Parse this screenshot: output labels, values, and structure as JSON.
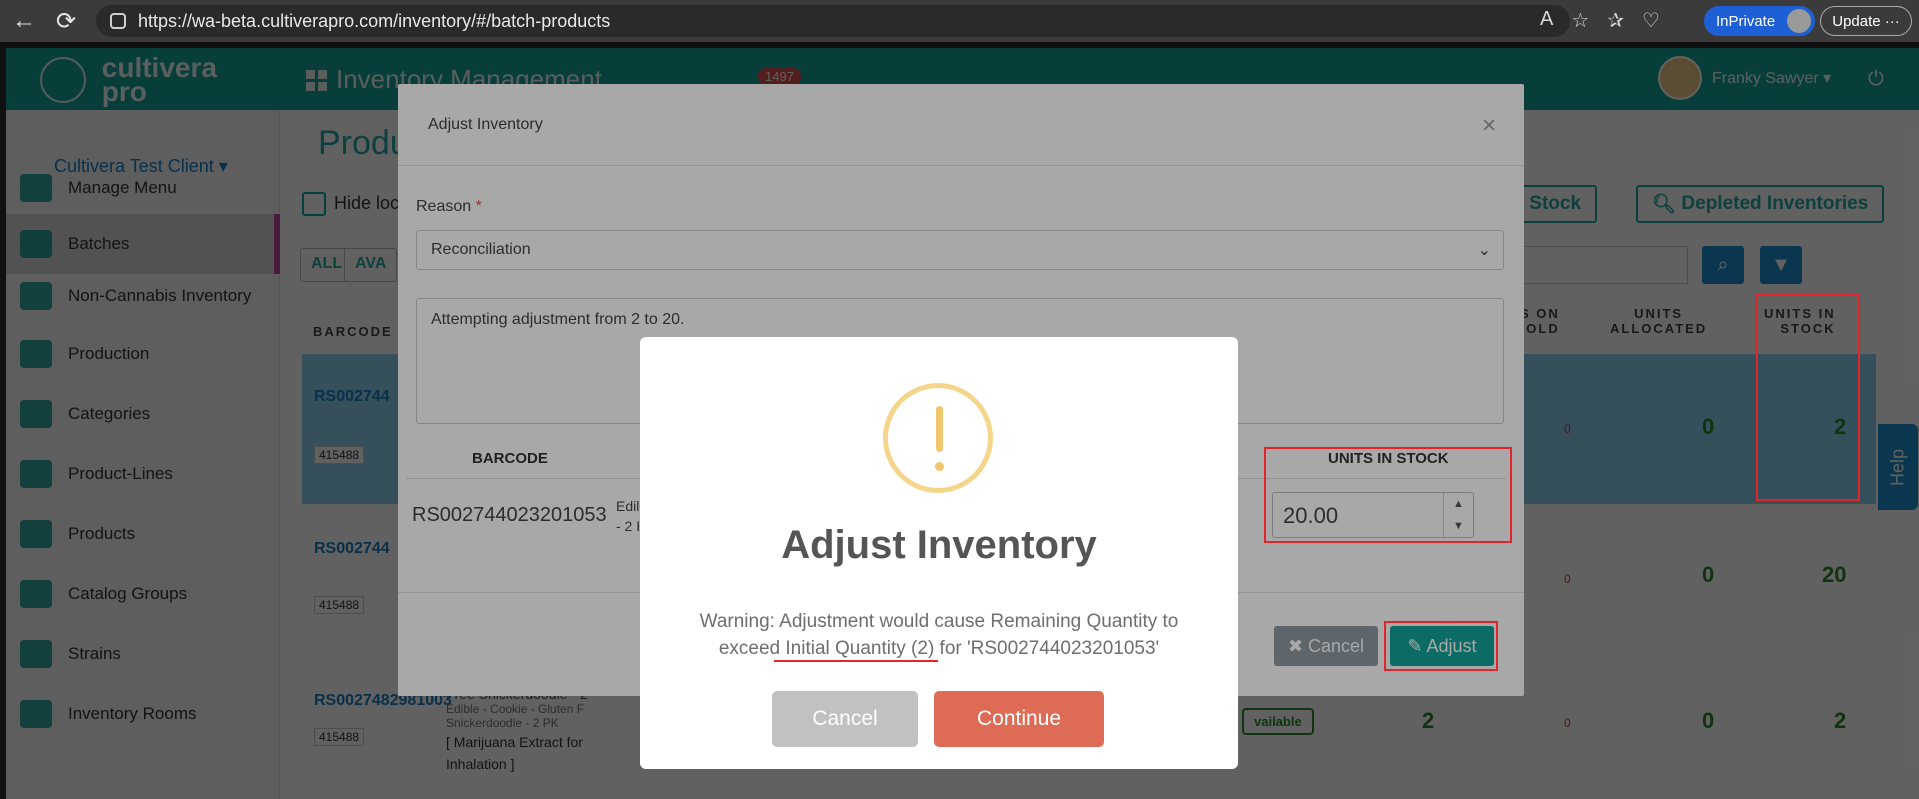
{
  "browser": {
    "url": "https://wa-beta.cultiverapro.com/inventory/#/batch-products",
    "inprivate_label": "InPrivate",
    "update_label": "Update ···"
  },
  "header": {
    "logo_line1": "cultivera",
    "logo_line2": "pro",
    "module_title": "Inventory Management",
    "notification_count": "1497",
    "user_name": "Franky Sawyer ▾"
  },
  "sidebar": {
    "client": "Cultivera Test Client ▾",
    "items": [
      {
        "label": "Manage Menu"
      },
      {
        "label": "Batches"
      },
      {
        "label": "Non-Cannabis Inventory"
      },
      {
        "label": "Production"
      },
      {
        "label": "Categories"
      },
      {
        "label": "Product-Lines"
      },
      {
        "label": "Products"
      },
      {
        "label": "Catalog Groups"
      },
      {
        "label": "Strains"
      },
      {
        "label": "Inventory Rooms"
      }
    ]
  },
  "main": {
    "page_title": "Produ",
    "hide_label": "Hide loc",
    "tab_all": "ALL",
    "tab_ava": "AVA",
    "only_in_stock": "ly in Stock",
    "depleted": "Depleted Inventories",
    "col_barcode": "BARCODE",
    "col_on_hold_1": "TS ON",
    "col_on_hold_2": "HOLD",
    "col_allocated_1": "UNITS",
    "col_allocated_2": "ALLOCATED",
    "col_instock_1": "UNITS IN",
    "col_instock_2": "STOCK",
    "rows": [
      {
        "barcode": "RS002744",
        "tag": "415488",
        "hold": "0",
        "allocated": "0",
        "instock": "2"
      },
      {
        "barcode": "RS002744",
        "tag": "415488",
        "hold": "0",
        "allocated": "0",
        "instock": "20"
      },
      {
        "barcode": "RS0027482981003",
        "tag": "415488",
        "name": "Free Snickerdoodle - 2",
        "meta": "Edible - Cookie - Gluten F",
        "meta2": "Snickerdoodle - 2 PK",
        "desc1": "[ Marijuana Extract for",
        "desc2": "Inhalation ]",
        "status": "vailable",
        "onhand": "2",
        "hold": "0",
        "allocated": "0",
        "instock": "2"
      }
    ],
    "help_label": "Help"
  },
  "modal": {
    "title": "Adjust Inventory",
    "close": "×",
    "reason_label": "Reason",
    "reason_required": "*",
    "reason_value": "Reconciliation",
    "notes": "Attempting adjustment from 2 to 20.",
    "th_barcode": "BARCODE",
    "th_units": "UNITS IN STOCK",
    "barcode": "RS002744023201053",
    "desc_line1": "Edil",
    "desc_line2": "- 2 I",
    "units_value": "20.00",
    "cancel_label": "✖ Cancel",
    "adjust_label": "✎ Adjust"
  },
  "dialog": {
    "title": "Adjust Inventory",
    "message": "Warning: Adjustment would cause Remaining Quantity to exceed Initial Quantity (2) for 'RS002744023201053'",
    "cancel_label": "Cancel",
    "continue_label": "Continue"
  },
  "colors": {
    "brand_teal": "#14a39a",
    "warning_yellow": "#f1c66c",
    "continue_red": "#dd6b55",
    "annotation_red": "#e0262c"
  }
}
